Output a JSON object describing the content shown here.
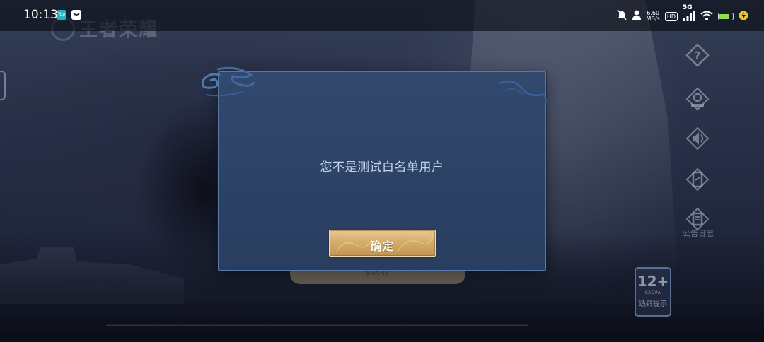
{
  "status_bar": {
    "time": "10:13",
    "app_icons": [
      "top-app-icon",
      "message-app-icon"
    ],
    "top_icon_text": "Top",
    "network_speed_value": "6.60",
    "network_speed_unit": "MB/s",
    "hd_label": "HD",
    "network_type": "5G",
    "battery_level": 0.8,
    "icons": [
      "mute-icon",
      "person-icon",
      "signal-icon",
      "wifi-icon",
      "battery-icon",
      "charging-icon"
    ]
  },
  "background": {
    "logo_text": "王者荣耀",
    "start_label": "START",
    "side_menu": [
      {
        "icon": "help-icon"
      },
      {
        "icon": "camera-icon"
      },
      {
        "icon": "speaker-icon"
      },
      {
        "icon": "phone-repair-icon"
      },
      {
        "icon": "announcement-icon",
        "label": "公告日志"
      }
    ],
    "age_rating": {
      "number": "12+",
      "org": "CADPA",
      "tip": "适龄提示"
    }
  },
  "dialog": {
    "message": "您不是测试白名单用户",
    "confirm_label": "确定"
  },
  "colors": {
    "dialog_bg": "#2d4366",
    "dialog_border": "#5878a6",
    "button_gold": "#d6ad6a",
    "message_text": "#c6d4ee"
  }
}
